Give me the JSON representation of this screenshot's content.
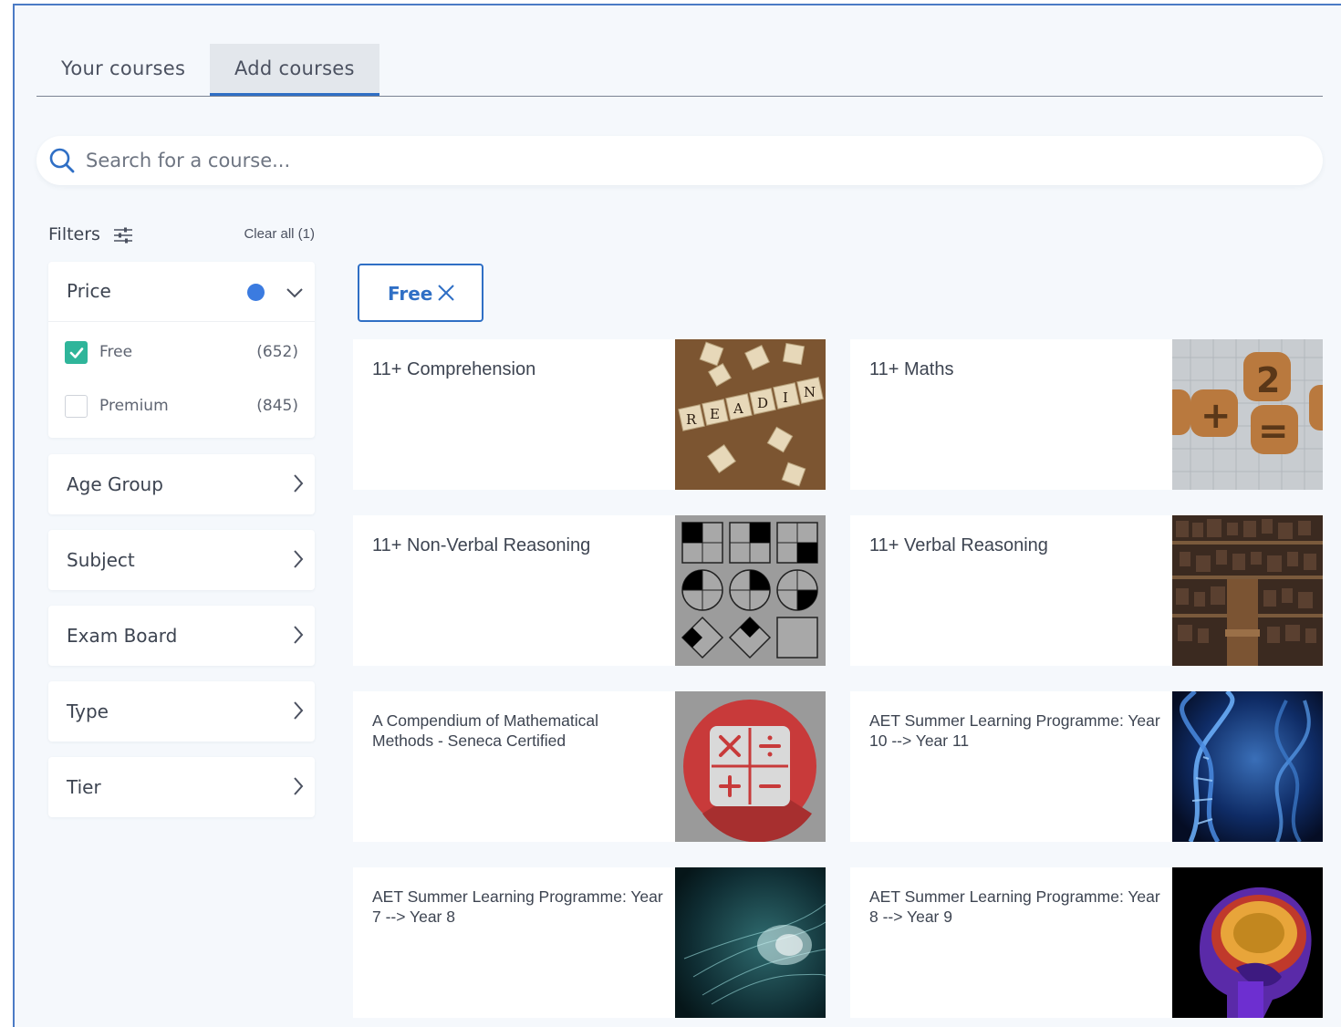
{
  "tabs": [
    {
      "label": "Your courses",
      "active": false
    },
    {
      "label": "Add courses",
      "active": true
    }
  ],
  "search": {
    "placeholder": "Search for a course..."
  },
  "filters": {
    "title": "Filters",
    "clear_all": "Clear all (1)",
    "price": {
      "label": "Price",
      "options": [
        {
          "label": "Free",
          "count": "(652)",
          "checked": true
        },
        {
          "label": "Premium",
          "count": "(845)",
          "checked": false
        }
      ]
    },
    "groups": [
      "Age Group",
      "Subject",
      "Exam Board",
      "Type",
      "Tier"
    ]
  },
  "active_filter_chip": "Free",
  "courses": [
    {
      "title": "11+ Comprehension",
      "image": "scrabble-tiles-reading-image"
    },
    {
      "title": "11+ Maths",
      "image": "cookie-math-symbols-image"
    },
    {
      "title": "11+ Non-Verbal Reasoning",
      "image": "shape-pattern-grid-image"
    },
    {
      "title": "11+ Verbal Reasoning",
      "image": "letterpress-type-blocks-image"
    },
    {
      "title": "A Compendium of Mathematical Methods - Seneca Certified",
      "image": "calculator-operators-icon-image"
    },
    {
      "title": "AET Summer Learning Programme: Year 10 --> Year 11",
      "image": "dna-helix-image"
    },
    {
      "title": "AET Summer Learning Programme: Year 7 --> Year 8",
      "image": "neural-network-image"
    },
    {
      "title": "AET Summer Learning Programme: Year 8 --> Year 9",
      "image": "brain-mri-scan-image"
    }
  ],
  "colors": {
    "accent": "#2f6fc5",
    "checkbox_checked": "#2fb59a",
    "indicator_dot": "#3b7be0",
    "page_bg": "#f5f8fc"
  }
}
